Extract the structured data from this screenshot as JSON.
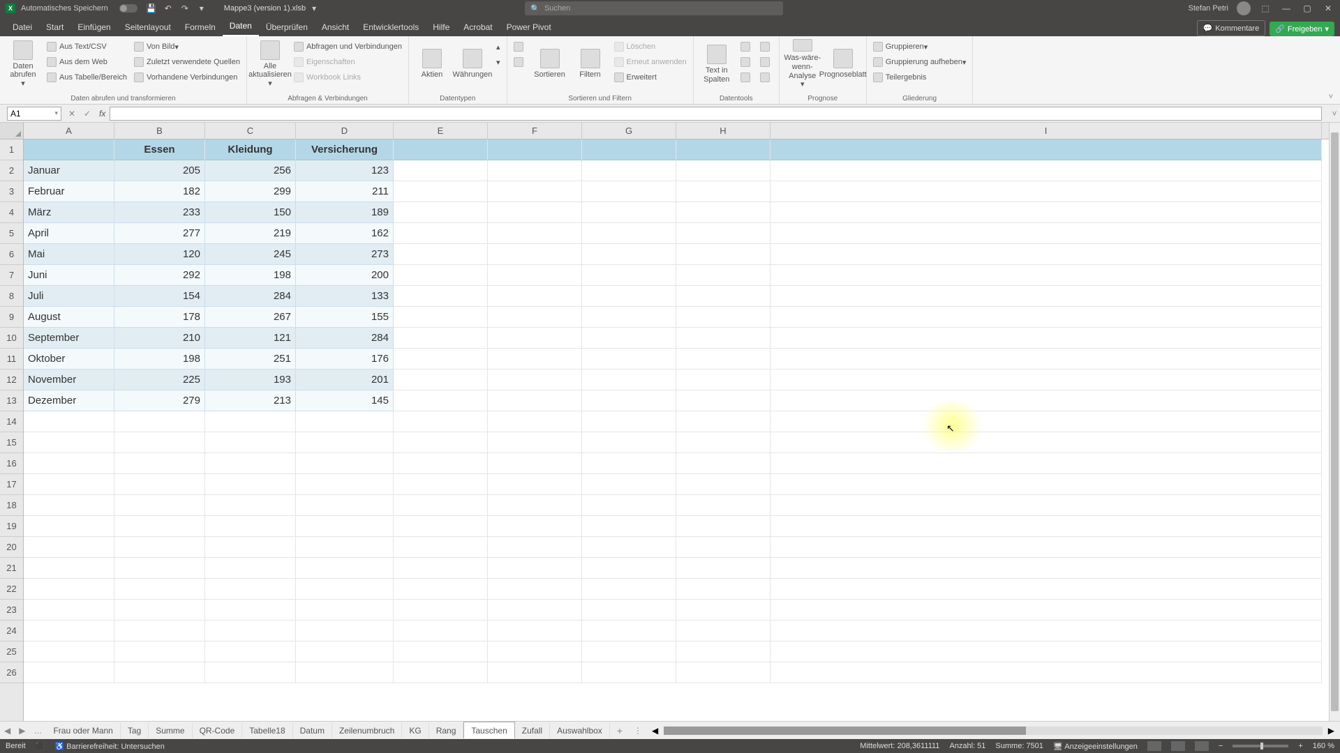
{
  "titlebar": {
    "autosave": "Automatisches Speichern",
    "filename": "Mappe3 (version 1).xlsb",
    "search_placeholder": "Suchen",
    "username": "Stefan Petri"
  },
  "menu": {
    "tabs": [
      "Datei",
      "Start",
      "Einfügen",
      "Seitenlayout",
      "Formeln",
      "Daten",
      "Überprüfen",
      "Ansicht",
      "Entwicklertools",
      "Hilfe",
      "Acrobat",
      "Power Pivot"
    ],
    "active_index": 5,
    "comments": "Kommentare",
    "share": "Freigeben"
  },
  "ribbon": {
    "group1": {
      "get_data": "Daten abrufen",
      "from_text": "Aus Text/CSV",
      "from_web": "Aus dem Web",
      "from_table": "Aus Tabelle/Bereich",
      "from_image": "Von Bild",
      "recent": "Zuletzt verwendete Quellen",
      "existing": "Vorhandene Verbindungen",
      "label": "Daten abrufen und transformieren"
    },
    "group2": {
      "refresh_all": "Alle aktualisieren",
      "queries": "Abfragen und Verbindungen",
      "properties": "Eigenschaften",
      "workbook_links": "Workbook Links",
      "label": "Abfragen & Verbindungen"
    },
    "group3": {
      "stocks": "Aktien",
      "currencies": "Währungen",
      "label": "Datentypen"
    },
    "group4": {
      "sort": "Sortieren",
      "filter": "Filtern",
      "clear": "Löschen",
      "reapply": "Erneut anwenden",
      "advanced": "Erweitert",
      "label": "Sortieren und Filtern"
    },
    "group5": {
      "text_to_cols": "Text in Spalten",
      "label": "Datentools"
    },
    "group6": {
      "whatif": "Was-wäre-wenn-Analyse",
      "forecast": "Prognoseblatt",
      "label": "Prognose"
    },
    "group7": {
      "group": "Gruppieren",
      "ungroup": "Gruppierung aufheben",
      "subtotal": "Teilergebnis",
      "label": "Gliederung"
    }
  },
  "namebox": "A1",
  "columns": [
    "A",
    "B",
    "C",
    "D",
    "E",
    "F",
    "G",
    "H",
    "I"
  ],
  "headers": [
    "",
    "Essen",
    "Kleidung",
    "Versicherung"
  ],
  "rows": [
    {
      "m": "Januar",
      "e": 205,
      "k": 256,
      "v": 123
    },
    {
      "m": "Februar",
      "e": 182,
      "k": 299,
      "v": 211
    },
    {
      "m": "März",
      "e": 233,
      "k": 150,
      "v": 189
    },
    {
      "m": "April",
      "e": 277,
      "k": 219,
      "v": 162
    },
    {
      "m": "Mai",
      "e": 120,
      "k": 245,
      "v": 273
    },
    {
      "m": "Juni",
      "e": 292,
      "k": 198,
      "v": 200
    },
    {
      "m": "Juli",
      "e": 154,
      "k": 284,
      "v": 133
    },
    {
      "m": "August",
      "e": 178,
      "k": 267,
      "v": 155
    },
    {
      "m": "September",
      "e": 210,
      "k": 121,
      "v": 284
    },
    {
      "m": "Oktober",
      "e": 198,
      "k": 251,
      "v": 176
    },
    {
      "m": "November",
      "e": 225,
      "k": 193,
      "v": 201
    },
    {
      "m": "Dezember",
      "e": 279,
      "k": 213,
      "v": 145
    }
  ],
  "sheet_tabs": [
    "Frau oder Mann",
    "Tag",
    "Summe",
    "QR-Code",
    "Tabelle18",
    "Datum",
    "Zeilenumbruch",
    "KG",
    "Rang",
    "Tauschen",
    "Zufall",
    "Auswahlbox"
  ],
  "active_sheet_index": 9,
  "statusbar": {
    "ready": "Bereit",
    "accessibility": "Barrierefreiheit: Untersuchen",
    "average": "Mittelwert: 208,3611111",
    "count": "Anzahl: 51",
    "sum": "Summe: 7501",
    "display": "Anzeigeeinstellungen",
    "zoom": "160 %"
  }
}
